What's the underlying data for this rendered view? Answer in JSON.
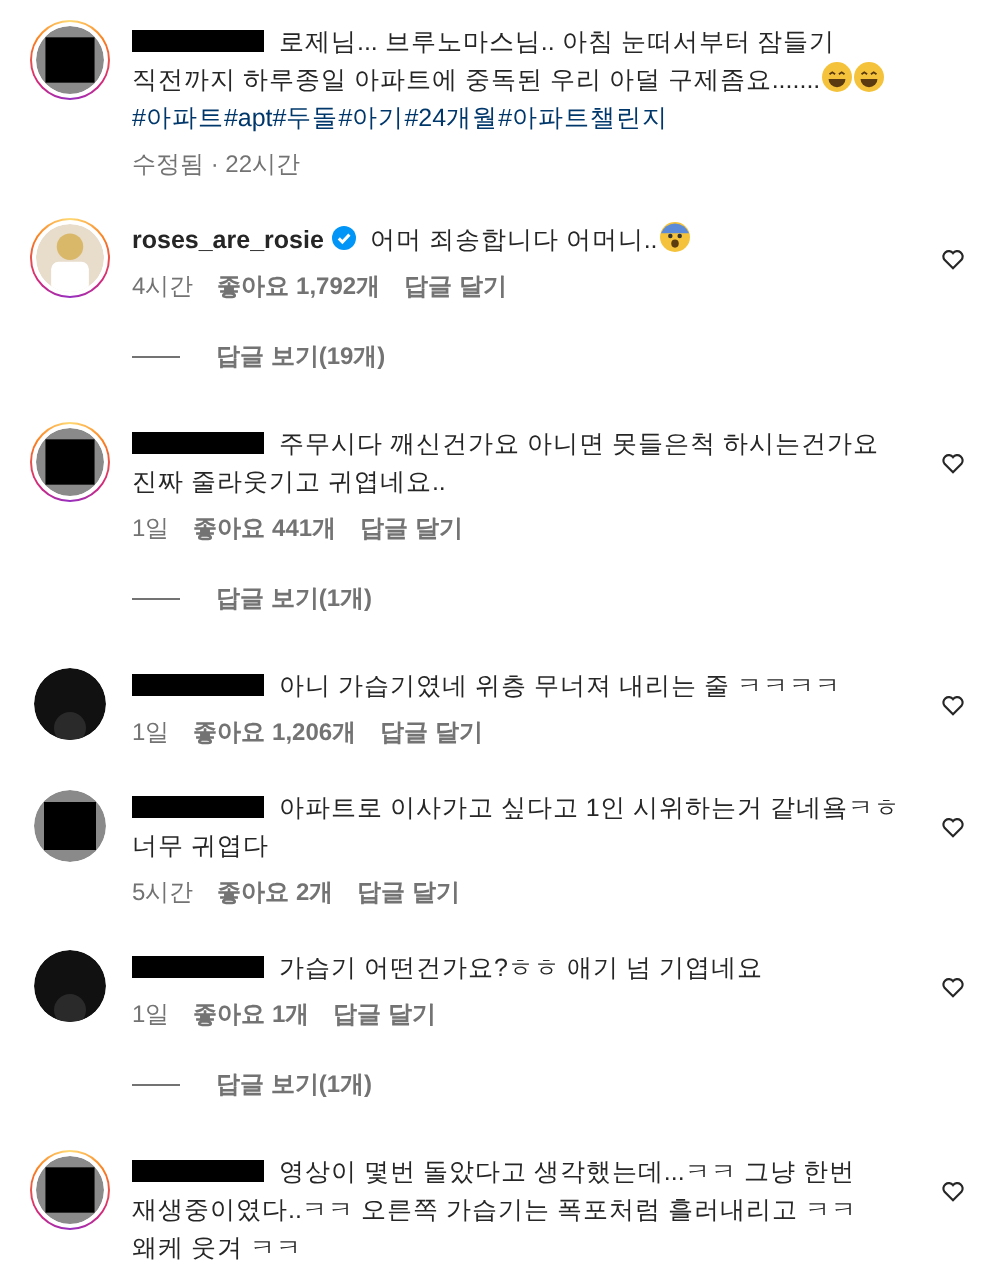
{
  "comments": [
    {
      "author": {
        "redacted": true,
        "story_ring": true,
        "avatar_redacted": true
      },
      "segments": [
        {
          "kind": "text",
          "text": "로제님... 브루노마스님.. 아침 눈떠서부터 잠들기 직전까지 하루종일 아파트에 중독된 우리 아덜 구제좀요......."
        },
        {
          "kind": "laughing_emoji"
        },
        {
          "kind": "laughing_emoji"
        },
        {
          "kind": "hashtag",
          "text": "#아파트"
        },
        {
          "kind": "hashtag",
          "text": "#apt"
        },
        {
          "kind": "hashtag",
          "text": "#두돌"
        },
        {
          "kind": "hashtag",
          "text": "#아기"
        },
        {
          "kind": "hashtag",
          "text": "#24개월"
        },
        {
          "kind": "hashtag",
          "text": "#아파트챌린지"
        }
      ],
      "time": "수정됨 · 22시간",
      "like_button": false
    },
    {
      "author": {
        "redacted": false,
        "name": "roses_are_rosie",
        "verified": true,
        "story_ring": true,
        "avatar_redacted": false
      },
      "segments": [
        {
          "kind": "text",
          "text": "어머 죄송합니다 어머니.."
        },
        {
          "kind": "fearful_emoji"
        }
      ],
      "time": "4시간",
      "likes": "좋아요 1,792개",
      "reply": "답글 달기",
      "like_button": true,
      "view_replies": "답글 보기(19개)"
    },
    {
      "author": {
        "redacted": true,
        "story_ring": true,
        "avatar_redacted": true
      },
      "segments": [
        {
          "kind": "text",
          "text": "주무시다 깨신건가요 아니면 못들은척 하시는건가요 진짜 줄라웃기고 귀엽네요.."
        }
      ],
      "time": "1일",
      "likes": "좋아요 441개",
      "reply": "답글 달기",
      "like_button": true,
      "view_replies": "답글 보기(1개)"
    },
    {
      "author": {
        "redacted": true,
        "story_ring": false,
        "avatar_redacted": false
      },
      "segments": [
        {
          "kind": "text",
          "text": "아니 가습기였네 위층 무너져 내리는 줄 ㅋㅋㅋㅋ"
        }
      ],
      "time": "1일",
      "likes": "좋아요 1,206개",
      "reply": "답글 달기",
      "like_button": true
    },
    {
      "author": {
        "redacted": true,
        "story_ring": false,
        "avatar_redacted": true
      },
      "segments": [
        {
          "kind": "text",
          "text": "아파트로 이사가고 싶다고 1인 시위하는거 같네욬ㅋㅎ 너무 귀엽다"
        }
      ],
      "time": "5시간",
      "likes": "좋아요 2개",
      "reply": "답글 달기",
      "like_button": true
    },
    {
      "author": {
        "redacted": true,
        "story_ring": false,
        "avatar_redacted": false
      },
      "segments": [
        {
          "kind": "text",
          "text": "가습기 어떤건가요?ㅎㅎ 애기 넘 기엽네요"
        }
      ],
      "time": "1일",
      "likes": "좋아요 1개",
      "reply": "답글 달기",
      "like_button": true,
      "view_replies": "답글 보기(1개)"
    },
    {
      "author": {
        "redacted": true,
        "story_ring": true,
        "avatar_redacted": true
      },
      "segments": [
        {
          "kind": "text",
          "text": "영상이 몇번 돌았다고 생각했는데...ㅋㅋ 그냥 한번 재생중이였다..ㅋㅋ 오른쪽 가습기는 폭포처럼 흘러내리고 ㅋㅋ 왜케 웃겨 ㅋㅋ"
        }
      ],
      "like_button": true
    }
  ]
}
